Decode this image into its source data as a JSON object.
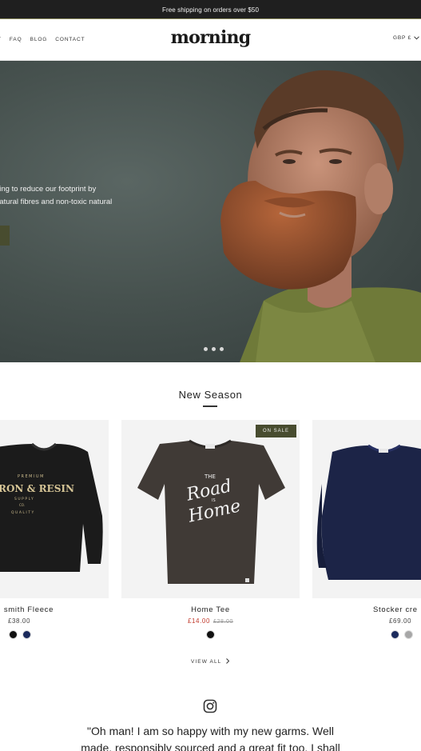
{
  "announcement": "Free shipping on orders over $50",
  "nav": {
    "items": [
      "T",
      "FAQ",
      "BLOG",
      "CONTACT"
    ]
  },
  "brand": {
    "logo": "morning"
  },
  "currency": {
    "label": "GBP £"
  },
  "hero": {
    "line1": "hing to reduce our footprint by",
    "line2": "natural fibres and non-toxic natural",
    "slides": 3
  },
  "section": {
    "title": "New Season"
  },
  "products": [
    {
      "name": "smith Fleece",
      "price": "£38.00",
      "swatches": [
        "#111111",
        "#1b2a5c"
      ]
    },
    {
      "name": "Home Tee",
      "sale_price": "£14.00",
      "compare_price": "£28.00",
      "badge": "ON SALE",
      "swatches": [
        "#111111"
      ]
    },
    {
      "name": "Stocker cre",
      "price": "£69.00",
      "swatches": [
        "#1b2a5c",
        "#a7a7a7"
      ]
    }
  ],
  "print": {
    "fleece": {
      "top": "PREMIUM",
      "main": "RON & RESIN",
      "sub": "SUPPLY",
      "co": "CO.",
      "bottom": "QUALITY"
    },
    "tee": {
      "the": "THE",
      "road": "Road",
      "is": "IS",
      "home": "Home"
    }
  },
  "view_all": "VIEW ALL",
  "testimonial": {
    "line1": "\"Oh man! I am so happy with my new garms. Well",
    "line2": "made, responsibly sourced and a great fit too. I shall"
  },
  "colors": {
    "accent": "#484c2f",
    "sale": "#c0392b",
    "bar": "#1f1f1f"
  },
  "icons": [
    "chevron-down-icon",
    "chevron-right-icon",
    "instagram-icon"
  ]
}
